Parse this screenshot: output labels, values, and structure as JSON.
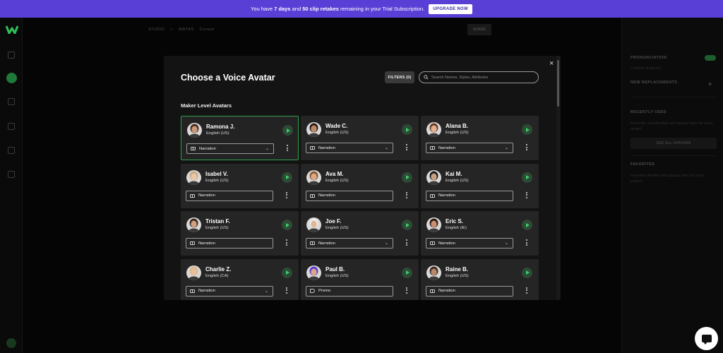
{
  "banner": {
    "text_before": "You have",
    "days": "7 days",
    "text_and": "and",
    "retakes": "50 clip retakes",
    "text_after": "remaining in your Trial Subscription.",
    "upgrade_label": "UPGRADE NOW"
  },
  "background": {
    "crumb_studio": "STUDIO",
    "crumb_sep": ">",
    "crumb_project": "AIRTAS",
    "crumb_tag": "Current",
    "share_label": "SHARE"
  },
  "right_panel": {
    "pronunciation": "PRONUNCIATION",
    "pron_text": "0 words replaced",
    "new_replacements": "NEW REPLACEMENTS",
    "recently_used": "RECENTLY USED",
    "recent_text": "Recently used Avatars will appear here for each project",
    "see_all": "SEE ALL AVATARS",
    "favorites": "FAVORITES",
    "fav_text": "Favorited Avatars will appear here for each project"
  },
  "modal": {
    "title": "Choose a Voice Avatar",
    "filters_label": "FILTERS (0)",
    "search_placeholder": "Search Names, Styles, Attributes",
    "section_title": "Maker Level Avatars",
    "close": "×"
  },
  "avatars": [
    {
      "name": "Ramona J.",
      "lang": "English (US)",
      "style": "Narration",
      "style_icon": "book-icon",
      "dropdown": true,
      "selected": true,
      "skin": "#c99a7a",
      "hair": "#4a2a1a"
    },
    {
      "name": "Wade C.",
      "lang": "English (US)",
      "style": "Narration",
      "style_icon": "book-icon",
      "dropdown": true,
      "selected": false,
      "skin": "#b98a6a",
      "hair": "#2a1a10"
    },
    {
      "name": "Alana B.",
      "lang": "English (US)",
      "style": "Narration",
      "style_icon": "book-icon",
      "dropdown": true,
      "selected": false,
      "skin": "#e0b090",
      "hair": "#6a3a20"
    },
    {
      "name": "Isabel V.",
      "lang": "English (US)",
      "style": "Narration",
      "style_icon": "book-icon",
      "dropdown": false,
      "selected": false,
      "skin": "#e8c8a8",
      "hair": "#c8a880"
    },
    {
      "name": "Ava M.",
      "lang": "English (US)",
      "style": "Narration",
      "style_icon": "book-icon",
      "dropdown": false,
      "selected": false,
      "skin": "#d8a888",
      "hair": "#8a5a30"
    },
    {
      "name": "Kai M.",
      "lang": "English (US)",
      "style": "Narration",
      "style_icon": "book-icon",
      "dropdown": false,
      "selected": false,
      "skin": "#c8a080",
      "hair": "#1a1a1a"
    },
    {
      "name": "Tristan F.",
      "lang": "English (US)",
      "style": "Narration",
      "style_icon": "book-icon",
      "dropdown": false,
      "selected": false,
      "skin": "#d0a080",
      "hair": "#3a2a20"
    },
    {
      "name": "Joe F.",
      "lang": "English (US)",
      "style": "Narration",
      "style_icon": "book-icon",
      "dropdown": true,
      "selected": false,
      "skin": "#e0b898",
      "hair": "#eeeeee"
    },
    {
      "name": "Eric S.",
      "lang": "English (IE)",
      "style": "Narration",
      "style_icon": "book-icon",
      "dropdown": true,
      "selected": false,
      "skin": "#c89070",
      "hair": "#2a1a10"
    },
    {
      "name": "Charlie Z.",
      "lang": "English (CA)",
      "style": "Narration",
      "style_icon": "book-icon",
      "dropdown": true,
      "selected": false,
      "skin": "#e8c0a0",
      "hair": "#d8b888"
    },
    {
      "name": "Paul B.",
      "lang": "English (US)",
      "style": "Promo",
      "style_icon": "megaphone-icon",
      "dropdown": false,
      "selected": false,
      "skin": "#d8a888",
      "hair": "#5a3ad0"
    },
    {
      "name": "Raine B.",
      "lang": "English (US)",
      "style": "Narration",
      "style_icon": "book-icon",
      "dropdown": false,
      "selected": false,
      "skin": "#b88868",
      "hair": "#3a2a20"
    }
  ]
}
